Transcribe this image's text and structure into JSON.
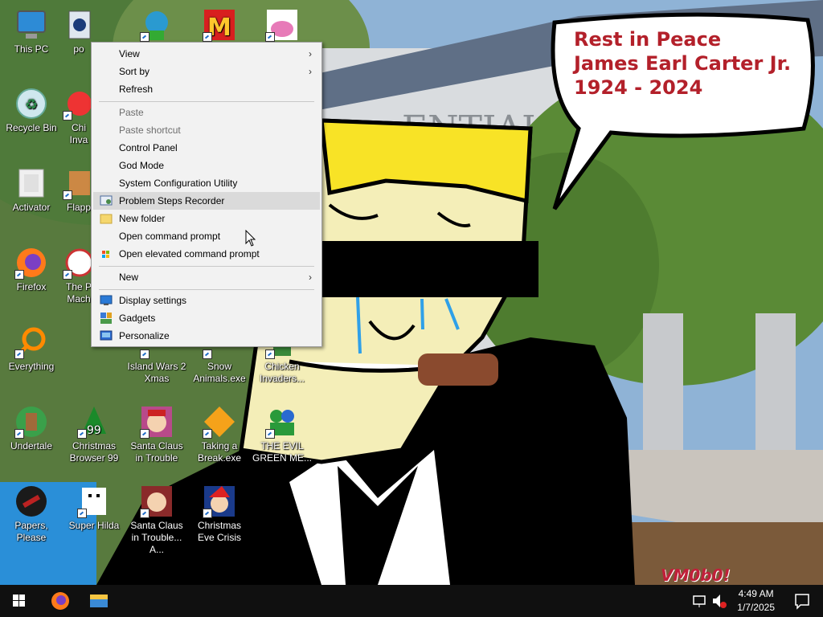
{
  "desktop": {
    "icons": [
      {
        "label": "This PC",
        "icon": "computer-icon"
      },
      {
        "label": "po",
        "icon": "app-icon"
      },
      {
        "label": "Recycle Bin",
        "icon": "recycle-bin-icon"
      },
      {
        "label": "Chi Inva",
        "icon": "game-icon"
      },
      {
        "label": "Activator",
        "icon": "activator-icon"
      },
      {
        "label": "Flapp",
        "icon": "game-icon"
      },
      {
        "label": "Firefox",
        "icon": "firefox-icon"
      },
      {
        "label": "The P Mach",
        "icon": "game-icon"
      },
      {
        "label": "Everything",
        "icon": "search-magnifier-icon"
      },
      {
        "label": "Island Wars 2 Xmas",
        "icon": "game-icon"
      },
      {
        "label": "Snow Animals.exe",
        "icon": "game-icon"
      },
      {
        "label": "Chicken Invaders...",
        "icon": "game-icon"
      },
      {
        "label": "Undertale",
        "icon": "undertale-icon"
      },
      {
        "label": "Christmas Browser 99",
        "icon": "christmas-tree-icon"
      },
      {
        "label": "Santa Claus in Trouble",
        "icon": "santa-icon"
      },
      {
        "label": "Taking a Break.exe",
        "icon": "game-icon"
      },
      {
        "label": "THE EVIL GREEN ME...",
        "icon": "messenger-icon"
      },
      {
        "label": "Papers, Please",
        "icon": "papers-please-icon"
      },
      {
        "label": "Super Hilda",
        "icon": "game-icon"
      },
      {
        "label": "Santa Claus in Trouble... A...",
        "icon": "santa-icon"
      },
      {
        "label": "Christmas Eve Crisis",
        "icon": "santa-icon"
      }
    ]
  },
  "context_menu": {
    "view": "View",
    "sort_by": "Sort by",
    "refresh": "Refresh",
    "paste": "Paste",
    "paste_shortcut": "Paste shortcut",
    "control_panel": "Control Panel",
    "god_mode": "God Mode",
    "system_configuration_utility": "System Configuration Utility",
    "problem_steps_recorder": "Problem Steps Recorder",
    "new_folder": "New folder",
    "open_command_prompt": "Open command prompt",
    "open_elevated_command_prompt": "Open elevated command prompt",
    "new": "New",
    "display_settings": "Display settings",
    "gadgets": "Gadgets",
    "personalize": "Personalize",
    "submenu_arrow": "›"
  },
  "wallpaper": {
    "bubble_line1": "Rest in Peace",
    "bubble_line2": "James Earl Carter Jr.",
    "bubble_line3": "1924 - 2024",
    "building_sign": "ENTIAL",
    "watermark": "VM0b0!"
  },
  "taskbar": {
    "time": "4:49 AM",
    "date": "1/7/2025"
  },
  "colors": {
    "taskbar": "#101010",
    "menu_bg": "#f2f2f2",
    "menu_hover": "#dadada",
    "bubble_text": "#b3202a"
  }
}
